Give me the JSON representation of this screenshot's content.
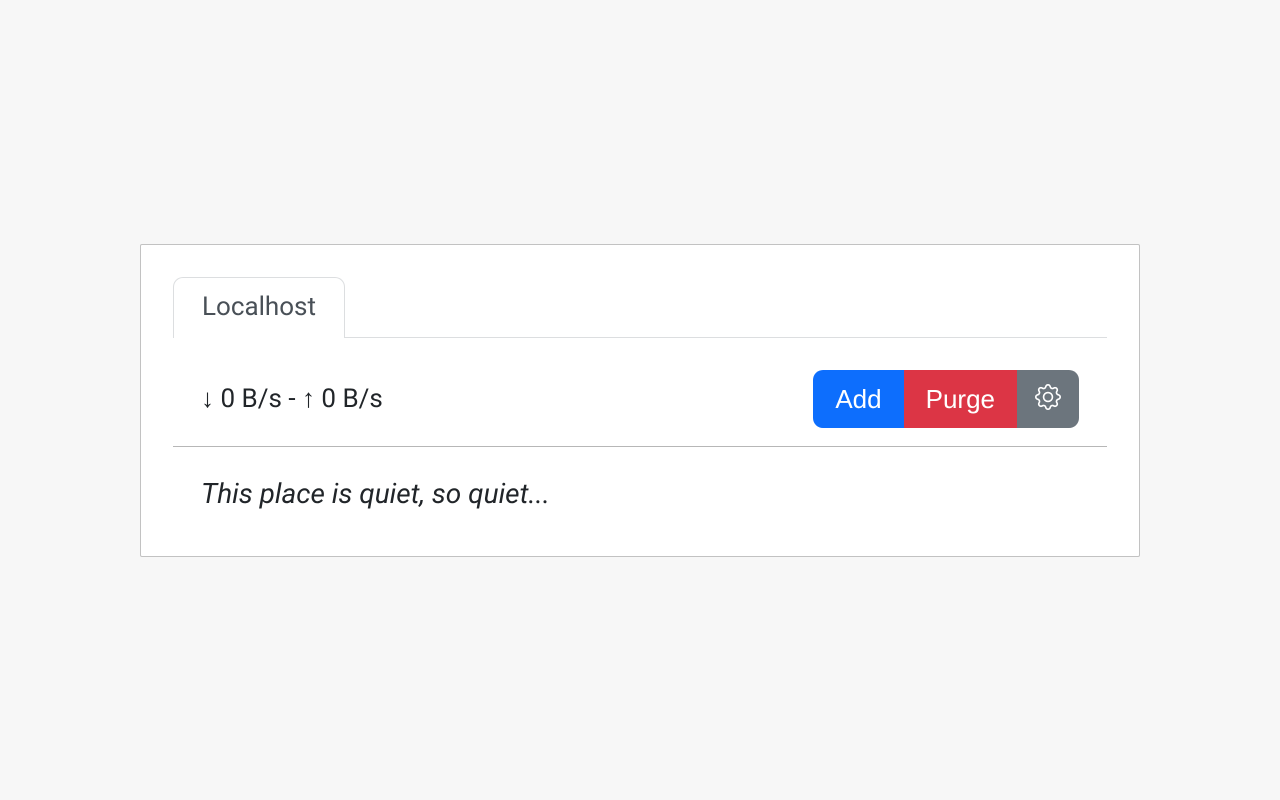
{
  "tabs": [
    {
      "label": "Localhost"
    }
  ],
  "speed": {
    "down_arrow": "↓",
    "down": "0 B/s",
    "sep": " - ",
    "up_arrow": "↑",
    "up": "0 B/s"
  },
  "actions": {
    "add_label": "Add",
    "purge_label": "Purge"
  },
  "empty_message": "This place is quiet, so quiet..."
}
